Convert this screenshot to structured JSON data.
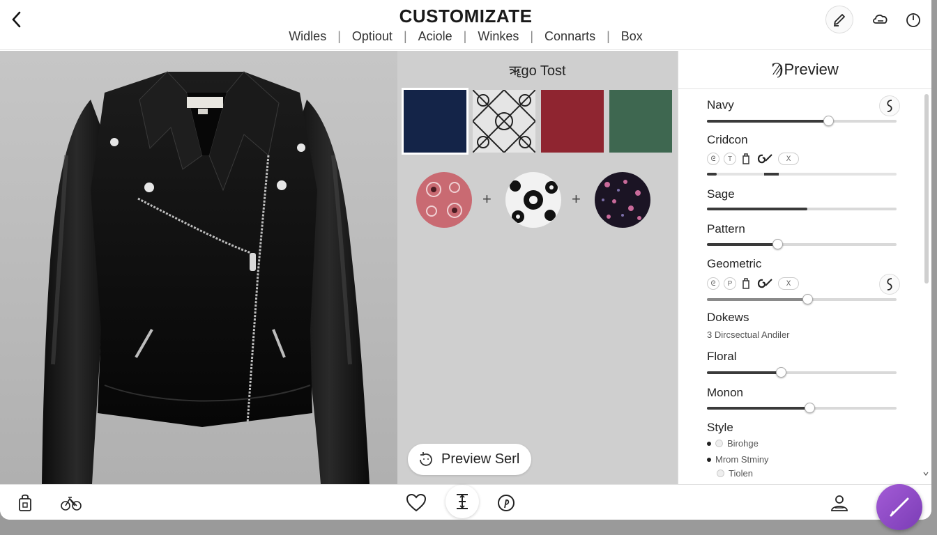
{
  "header": {
    "title": "CUSTOMIZATE",
    "tabs": [
      "Widles",
      "Optiout",
      "Aciole",
      "Winkes",
      "Connarts",
      "Box"
    ]
  },
  "middle": {
    "title": "ॠgo Tost",
    "swatch_colors": [
      "#142448",
      "#e5e5e5",
      "#8f2530",
      "#3e6750"
    ],
    "pattern_circles": [
      "rose-floral-pattern",
      "black-white-floral-pattern",
      "dark-dotted-pattern"
    ],
    "plus": "+",
    "preview_button": "Preview Serl"
  },
  "right": {
    "title": "Preview",
    "title_glyph": "Ϡ",
    "rows": {
      "navy": {
        "label": "Navy",
        "value": 0.64
      },
      "cridcon": {
        "label": "Cridcon",
        "value_a": 0.05,
        "value_b": 0.38
      },
      "sage": {
        "label": "Sage",
        "value": 0.53
      },
      "pattern": {
        "label": "Pattern",
        "value": 0.37
      },
      "geometric": {
        "label": "Geometric",
        "value": 0.53
      },
      "dokews": {
        "label": "Dokews",
        "sub": "3 Dircsectual Andiler"
      },
      "floral": {
        "label": "Floral",
        "value": 0.39
      },
      "monon": {
        "label": "Monon",
        "value": 0.54
      },
      "style": {
        "label": "Style",
        "options": [
          "Birohge",
          "Mrom Stminy",
          "Tiolen"
        ]
      }
    },
    "mini_icons": [
      "T",
      "P"
    ]
  },
  "colors": {
    "accent": "#8e4cc7",
    "panel_mid": "#cfcfcf"
  }
}
